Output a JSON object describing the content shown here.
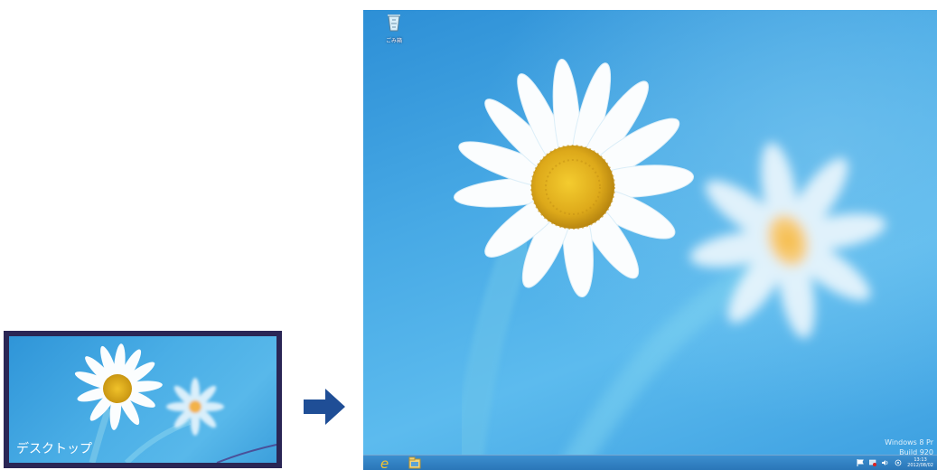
{
  "tile": {
    "label": "デスクトップ"
  },
  "desktop": {
    "recycle_bin_label": "ごみ箱",
    "watermark": {
      "line1": "Windows 8 Pr",
      "line2": "Build 920"
    },
    "clock": {
      "time": "13:13",
      "date": "2012/08/02"
    }
  },
  "colors": {
    "tile_border": "#2a2655",
    "sky_blue": "#47a9e5",
    "arrow_blue": "#1f4e96",
    "taskbar": "#2a76b8",
    "flower_center": "#e3b21c"
  },
  "icons": [
    "recycle-bin-icon",
    "arrow-right-icon",
    "internet-explorer-icon",
    "file-explorer-icon",
    "flag-icon",
    "network-icon",
    "volume-icon",
    "power-icon"
  ]
}
